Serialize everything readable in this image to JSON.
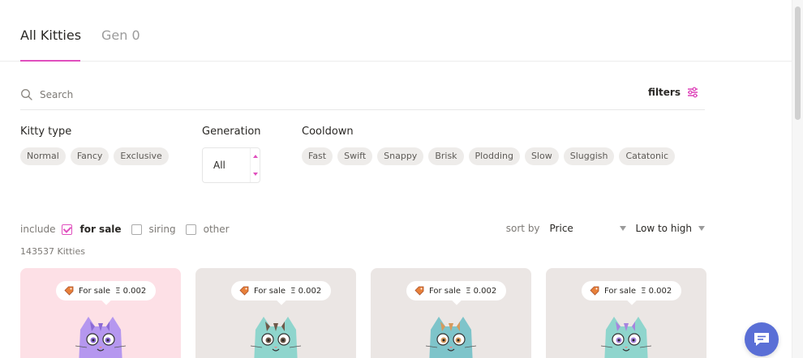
{
  "tabs": {
    "all_kitties": "All Kitties",
    "gen0": "Gen 0"
  },
  "search": {
    "placeholder": "Search",
    "filters_label": "filters"
  },
  "kitty_type": {
    "title": "Kitty type",
    "options": [
      "Normal",
      "Fancy",
      "Exclusive"
    ]
  },
  "generation": {
    "title": "Generation",
    "value": "All"
  },
  "cooldown": {
    "title": "Cooldown",
    "options": [
      "Fast",
      "Swift",
      "Snappy",
      "Brisk",
      "Plodding",
      "Slow",
      "Sluggish",
      "Catatonic"
    ]
  },
  "include": {
    "label": "include",
    "options": [
      {
        "label": "for sale",
        "checked": true
      },
      {
        "label": "siring",
        "checked": false
      },
      {
        "label": "other",
        "checked": false
      }
    ]
  },
  "sort": {
    "label": "sort by",
    "field": "Price",
    "order": "Low to high"
  },
  "count_text": "143537 Kitties",
  "cards": [
    {
      "status": "For sale",
      "price": "Ξ 0.002",
      "bg": "#fde0e6",
      "body": "#b597ef",
      "spot": "#8c6ad6"
    },
    {
      "status": "For sale",
      "price": "Ξ 0.002",
      "bg": "#ebe6e4",
      "body": "#8fd5cd",
      "spot": "#6f5a4a"
    },
    {
      "status": "For sale",
      "price": "Ξ 0.002",
      "bg": "#ebe6e4",
      "body": "#7ec4ca",
      "spot": "#d69a5c"
    },
    {
      "status": "For sale",
      "price": "Ξ 0.002",
      "bg": "#ebe6e4",
      "body": "#8fd5cd",
      "spot": "#a784e0"
    }
  ],
  "colors": {
    "accent": "#e04fbe",
    "chat": "#5a6fd6"
  }
}
